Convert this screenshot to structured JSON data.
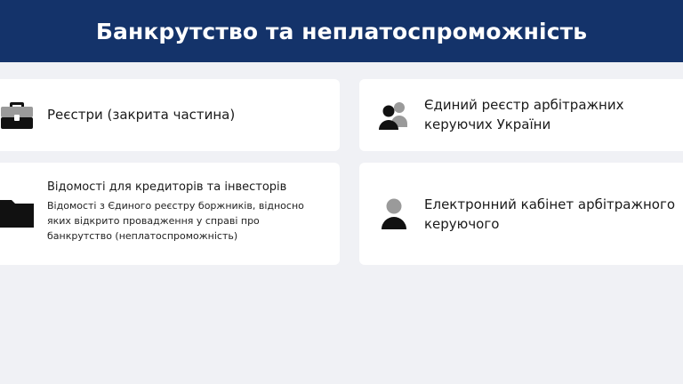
{
  "header": {
    "title": "Банкрутство та неплатоспроможність"
  },
  "cards": {
    "registers": {
      "title": "Реєстри (закрита частина)",
      "icon": "briefcase-icon"
    },
    "unified": {
      "title": "Єдиний реєстр арбітражних керуючих України",
      "icon": "users-icon"
    },
    "info": {
      "title": "Відомості для кредиторів та інвесторів",
      "description": "Відомості з Єдиного реєстру боржників, відносно яких відкрито провадження у справі про банкрутство (неплатоспроможність)",
      "icon": "folder-icon"
    },
    "cabinet": {
      "title": "Електронний кабінет арбітражного керуючого",
      "icon": "user-icon"
    }
  },
  "colors": {
    "header_bg": "#14336a",
    "page_bg": "#f0f1f5",
    "card_bg": "#ffffff"
  }
}
